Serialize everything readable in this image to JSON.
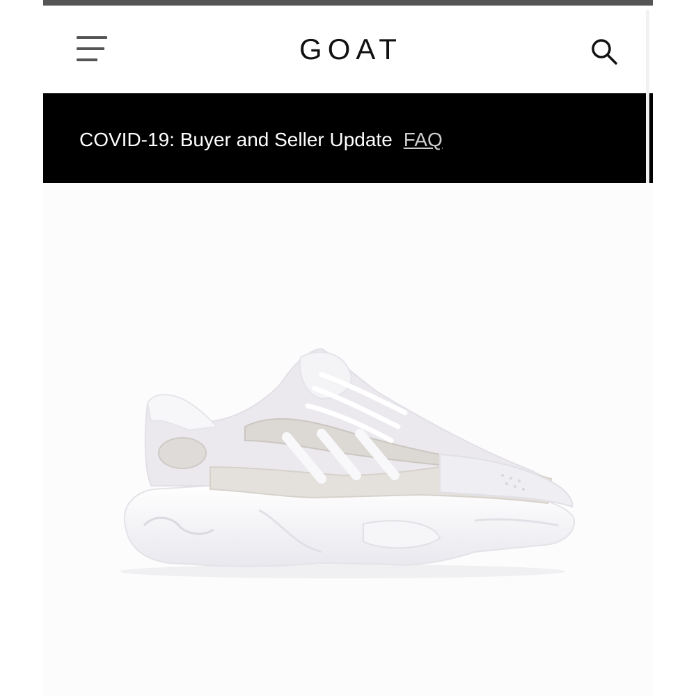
{
  "header": {
    "brand": "GOAT",
    "menu_icon": "hamburger-menu-icon",
    "search_icon": "search-icon"
  },
  "banner": {
    "text": "COVID-19: Buyer and Seller Update",
    "link_label": "FAQ"
  },
  "product": {
    "image": "sneaker-image"
  },
  "colors": {
    "banner_bg": "#000000",
    "banner_text": "#ffffff",
    "brand_text": "#111111",
    "icon": "#555555"
  }
}
